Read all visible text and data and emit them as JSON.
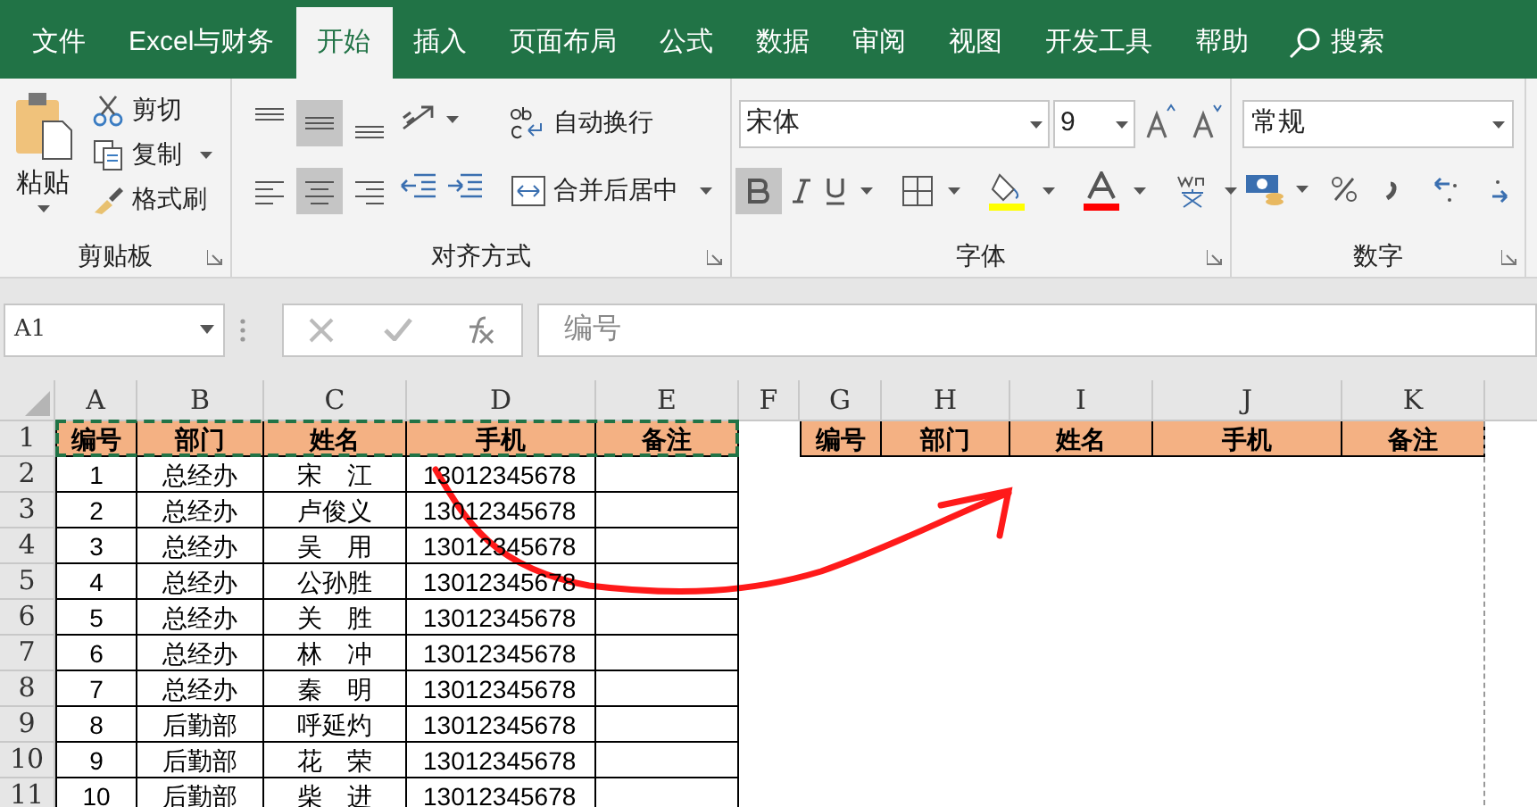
{
  "tabs": [
    {
      "label": "文件",
      "selected": false
    },
    {
      "label": "Excel与财务",
      "selected": false
    },
    {
      "label": "开始",
      "selected": true
    },
    {
      "label": "插入",
      "selected": false
    },
    {
      "label": "页面布局",
      "selected": false
    },
    {
      "label": "公式",
      "selected": false
    },
    {
      "label": "数据",
      "selected": false
    },
    {
      "label": "审阅",
      "selected": false
    },
    {
      "label": "视图",
      "selected": false
    },
    {
      "label": "开发工具",
      "selected": false
    },
    {
      "label": "帮助",
      "selected": false
    }
  ],
  "search": {
    "label": "搜索"
  },
  "clipboard": {
    "paste": "粘贴",
    "cut": "剪切",
    "copy": "复制",
    "format_painter": "格式刷",
    "group": "剪贴板"
  },
  "alignment": {
    "vertical": [
      {
        "selected": false
      },
      {
        "selected": true
      },
      {
        "selected": false
      }
    ],
    "horizontal": [
      {
        "selected": false
      },
      {
        "selected": true
      },
      {
        "selected": false
      }
    ],
    "wrap": "自动换行",
    "merge": "合并后居中",
    "group": "对齐方式"
  },
  "font": {
    "name": "宋体",
    "size": "9",
    "bold": true,
    "group": "字体"
  },
  "number": {
    "format": "常规",
    "group": "数字"
  },
  "formula_bar": {
    "name_box": "A1",
    "content": "编号"
  },
  "columns": [
    "A",
    "B",
    "C",
    "D",
    "E",
    "F",
    "G",
    "H",
    "I",
    "J",
    "K"
  ],
  "row_numbers": [
    "1",
    "2",
    "3",
    "4",
    "5",
    "6",
    "7",
    "8",
    "9",
    "10",
    "11"
  ],
  "source_table": {
    "headers": [
      "编号",
      "部门",
      "姓名",
      "手机",
      "备注"
    ],
    "copied": true,
    "rows": [
      [
        "1",
        "总经办",
        "宋　江",
        "13012345678"
      ],
      [
        "2",
        "总经办",
        "卢俊义",
        "13012345678"
      ],
      [
        "3",
        "总经办",
        "吴　用",
        "13012345678"
      ],
      [
        "4",
        "总经办",
        "公孙胜",
        "13012345678"
      ],
      [
        "5",
        "总经办",
        "关　胜",
        "13012345678"
      ],
      [
        "6",
        "总经办",
        "林　冲",
        "13012345678"
      ],
      [
        "7",
        "总经办",
        "秦　明",
        "13012345678"
      ],
      [
        "8",
        "后勤部",
        "呼延灼",
        "13012345678"
      ],
      [
        "9",
        "后勤部",
        "花　荣",
        "13012345678"
      ],
      [
        "10",
        "后勤部",
        "柴　进",
        "13012345678"
      ]
    ]
  },
  "target_table": {
    "headers": [
      "编号",
      "部门",
      "姓名",
      "手机",
      "备注"
    ]
  }
}
